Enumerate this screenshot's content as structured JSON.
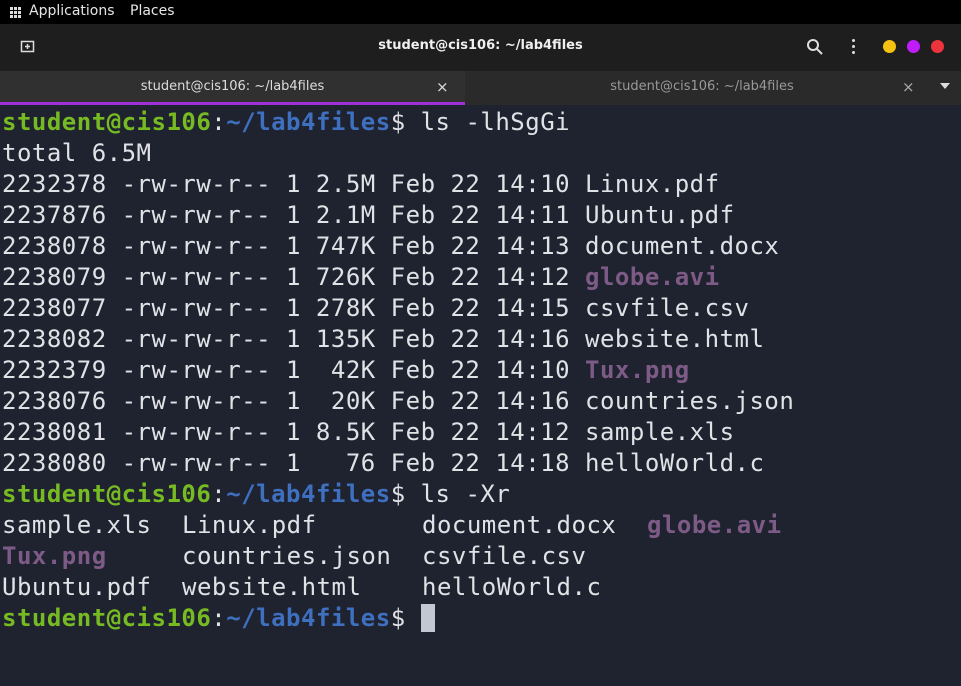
{
  "panel": {
    "applications": "Applications",
    "places": "Places"
  },
  "window": {
    "title": "student@cis106: ~/lab4files",
    "tabs": [
      {
        "label": "student@cis106: ~/lab4files",
        "close": "×"
      },
      {
        "label": "student@cis106: ~/lab4files",
        "close": "×"
      }
    ]
  },
  "prompt": {
    "user": "student@cis106",
    "colon": ":",
    "path": "~/lab4files",
    "dollar": "$"
  },
  "commands": {
    "first": " ls -lhSgGi",
    "second": " ls -Xr"
  },
  "listing": {
    "total": "total 6.5M",
    "rows": [
      {
        "prefix": "2232378 -rw-rw-r-- 1 2.5M Feb 22 14:10 ",
        "name": "Linux.pdf",
        "media": false
      },
      {
        "prefix": "2237876 -rw-rw-r-- 1 2.1M Feb 22 14:11 ",
        "name": "Ubuntu.pdf",
        "media": false
      },
      {
        "prefix": "2238078 -rw-rw-r-- 1 747K Feb 22 14:13 ",
        "name": "document.docx",
        "media": false
      },
      {
        "prefix": "2238079 -rw-rw-r-- 1 726K Feb 22 14:12 ",
        "name": "globe.avi",
        "media": true
      },
      {
        "prefix": "2238077 -rw-rw-r-- 1 278K Feb 22 14:15 ",
        "name": "csvfile.csv",
        "media": false
      },
      {
        "prefix": "2238082 -rw-rw-r-- 1 135K Feb 22 14:16 ",
        "name": "website.html",
        "media": false
      },
      {
        "prefix": "2232379 -rw-rw-r-- 1  42K Feb 22 14:10 ",
        "name": "Tux.png",
        "media": true
      },
      {
        "prefix": "2238076 -rw-rw-r-- 1  20K Feb 22 14:16 ",
        "name": "countries.json",
        "media": false
      },
      {
        "prefix": "2238081 -rw-rw-r-- 1 8.5K Feb 22 14:12 ",
        "name": "sample.xls",
        "media": false
      },
      {
        "prefix": "2238080 -rw-rw-r-- 1   76 Feb 22 14:18 ",
        "name": "helloWorld.c",
        "media": false
      }
    ]
  },
  "grid": {
    "rows": [
      [
        "sample.xls",
        "Linux.pdf",
        "document.docx",
        "globe.avi"
      ],
      [
        "Tux.png",
        "countries.json",
        "csvfile.csv",
        ""
      ],
      [
        "Ubuntu.pdf",
        "website.html",
        "helloWorld.c",
        ""
      ]
    ],
    "media": [
      "globe.avi",
      "Tux.png"
    ]
  },
  "colors": {
    "prompt_user": "#77bb22",
    "prompt_path": "#3f6fbf",
    "media_file": "#7d5b86",
    "tab_accent": "#a031d7"
  }
}
